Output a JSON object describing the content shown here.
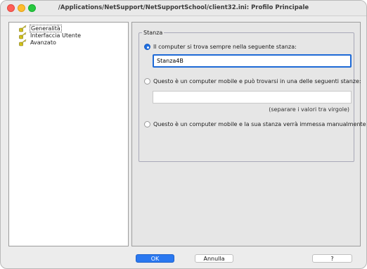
{
  "window": {
    "title": "/Applications/NetSupport/NetSupportSchool/client32.ini: Profilo Principale"
  },
  "tree": {
    "items": [
      {
        "label": "Generalità",
        "icon": "settings-key-icon",
        "selected": true
      },
      {
        "label": "Interfaccia Utente",
        "icon": "settings-key-icon",
        "selected": false
      },
      {
        "label": "Avanzato",
        "icon": "settings-key-icon",
        "selected": false
      }
    ]
  },
  "room": {
    "group_title": "Stanza",
    "option_fixed": {
      "label": "Il computer si trova sempre nella seguente stanza:",
      "selected": true,
      "value": "Stanza4B"
    },
    "option_mobile": {
      "label": "Questo è un computer mobile e può trovarsi in una delle seguenti stanze:",
      "selected": false,
      "value": "",
      "hint": "(separare i valori tra virgole)"
    },
    "option_manual": {
      "label": "Questo è un computer mobile e la sua stanza verrà immessa manualmente",
      "selected": false
    }
  },
  "buttons": {
    "ok": "OK",
    "cancel": "Annulla",
    "help": "?"
  },
  "colors": {
    "accent": "#2a78f0",
    "traffic_close": "#fe5f57",
    "traffic_min": "#febc2e",
    "traffic_max": "#28c840",
    "tree_icon": "#d4c41a"
  }
}
